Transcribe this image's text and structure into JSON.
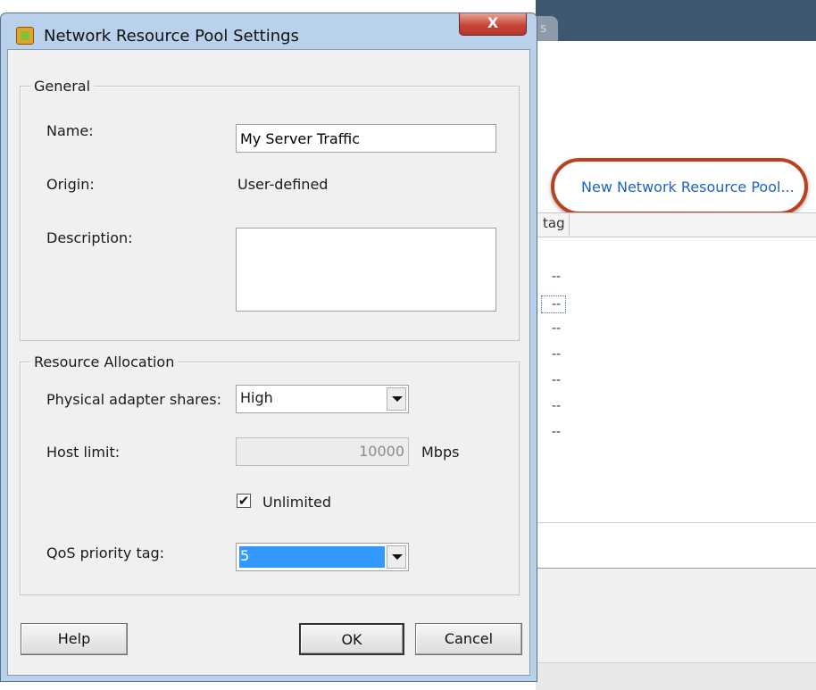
{
  "background": {
    "tab_label": "s",
    "new_pool_link": "New Network Resource Pool...",
    "grid": {
      "column_header": "tag",
      "cells": [
        "--",
        "--",
        "--",
        "--",
        "--",
        "--",
        "--"
      ],
      "selected_index": 1
    }
  },
  "dialog": {
    "title": "Network Resource Pool Settings",
    "close_glyph": "X",
    "general": {
      "legend": "General",
      "name_label": "Name:",
      "name_value": "My Server Traffic",
      "origin_label": "Origin:",
      "origin_value": "User-defined",
      "description_label": "Description:",
      "description_value": ""
    },
    "resource_allocation": {
      "legend": "Resource Allocation",
      "shares_label": "Physical adapter shares:",
      "shares_value": "High",
      "host_limit_label": "Host limit:",
      "host_limit_value": "10000",
      "host_limit_unit": "Mbps",
      "unlimited_label": "Unlimited",
      "unlimited_checked": true,
      "qos_label": "QoS priority tag:",
      "qos_value": "5"
    },
    "buttons": {
      "help": "Help",
      "ok": "OK",
      "cancel": "Cancel"
    }
  },
  "colors": {
    "link": "#1f63c4",
    "highlight_oval": "#b8421f",
    "selection": "#3399ff",
    "close_button": "#c8453a"
  }
}
